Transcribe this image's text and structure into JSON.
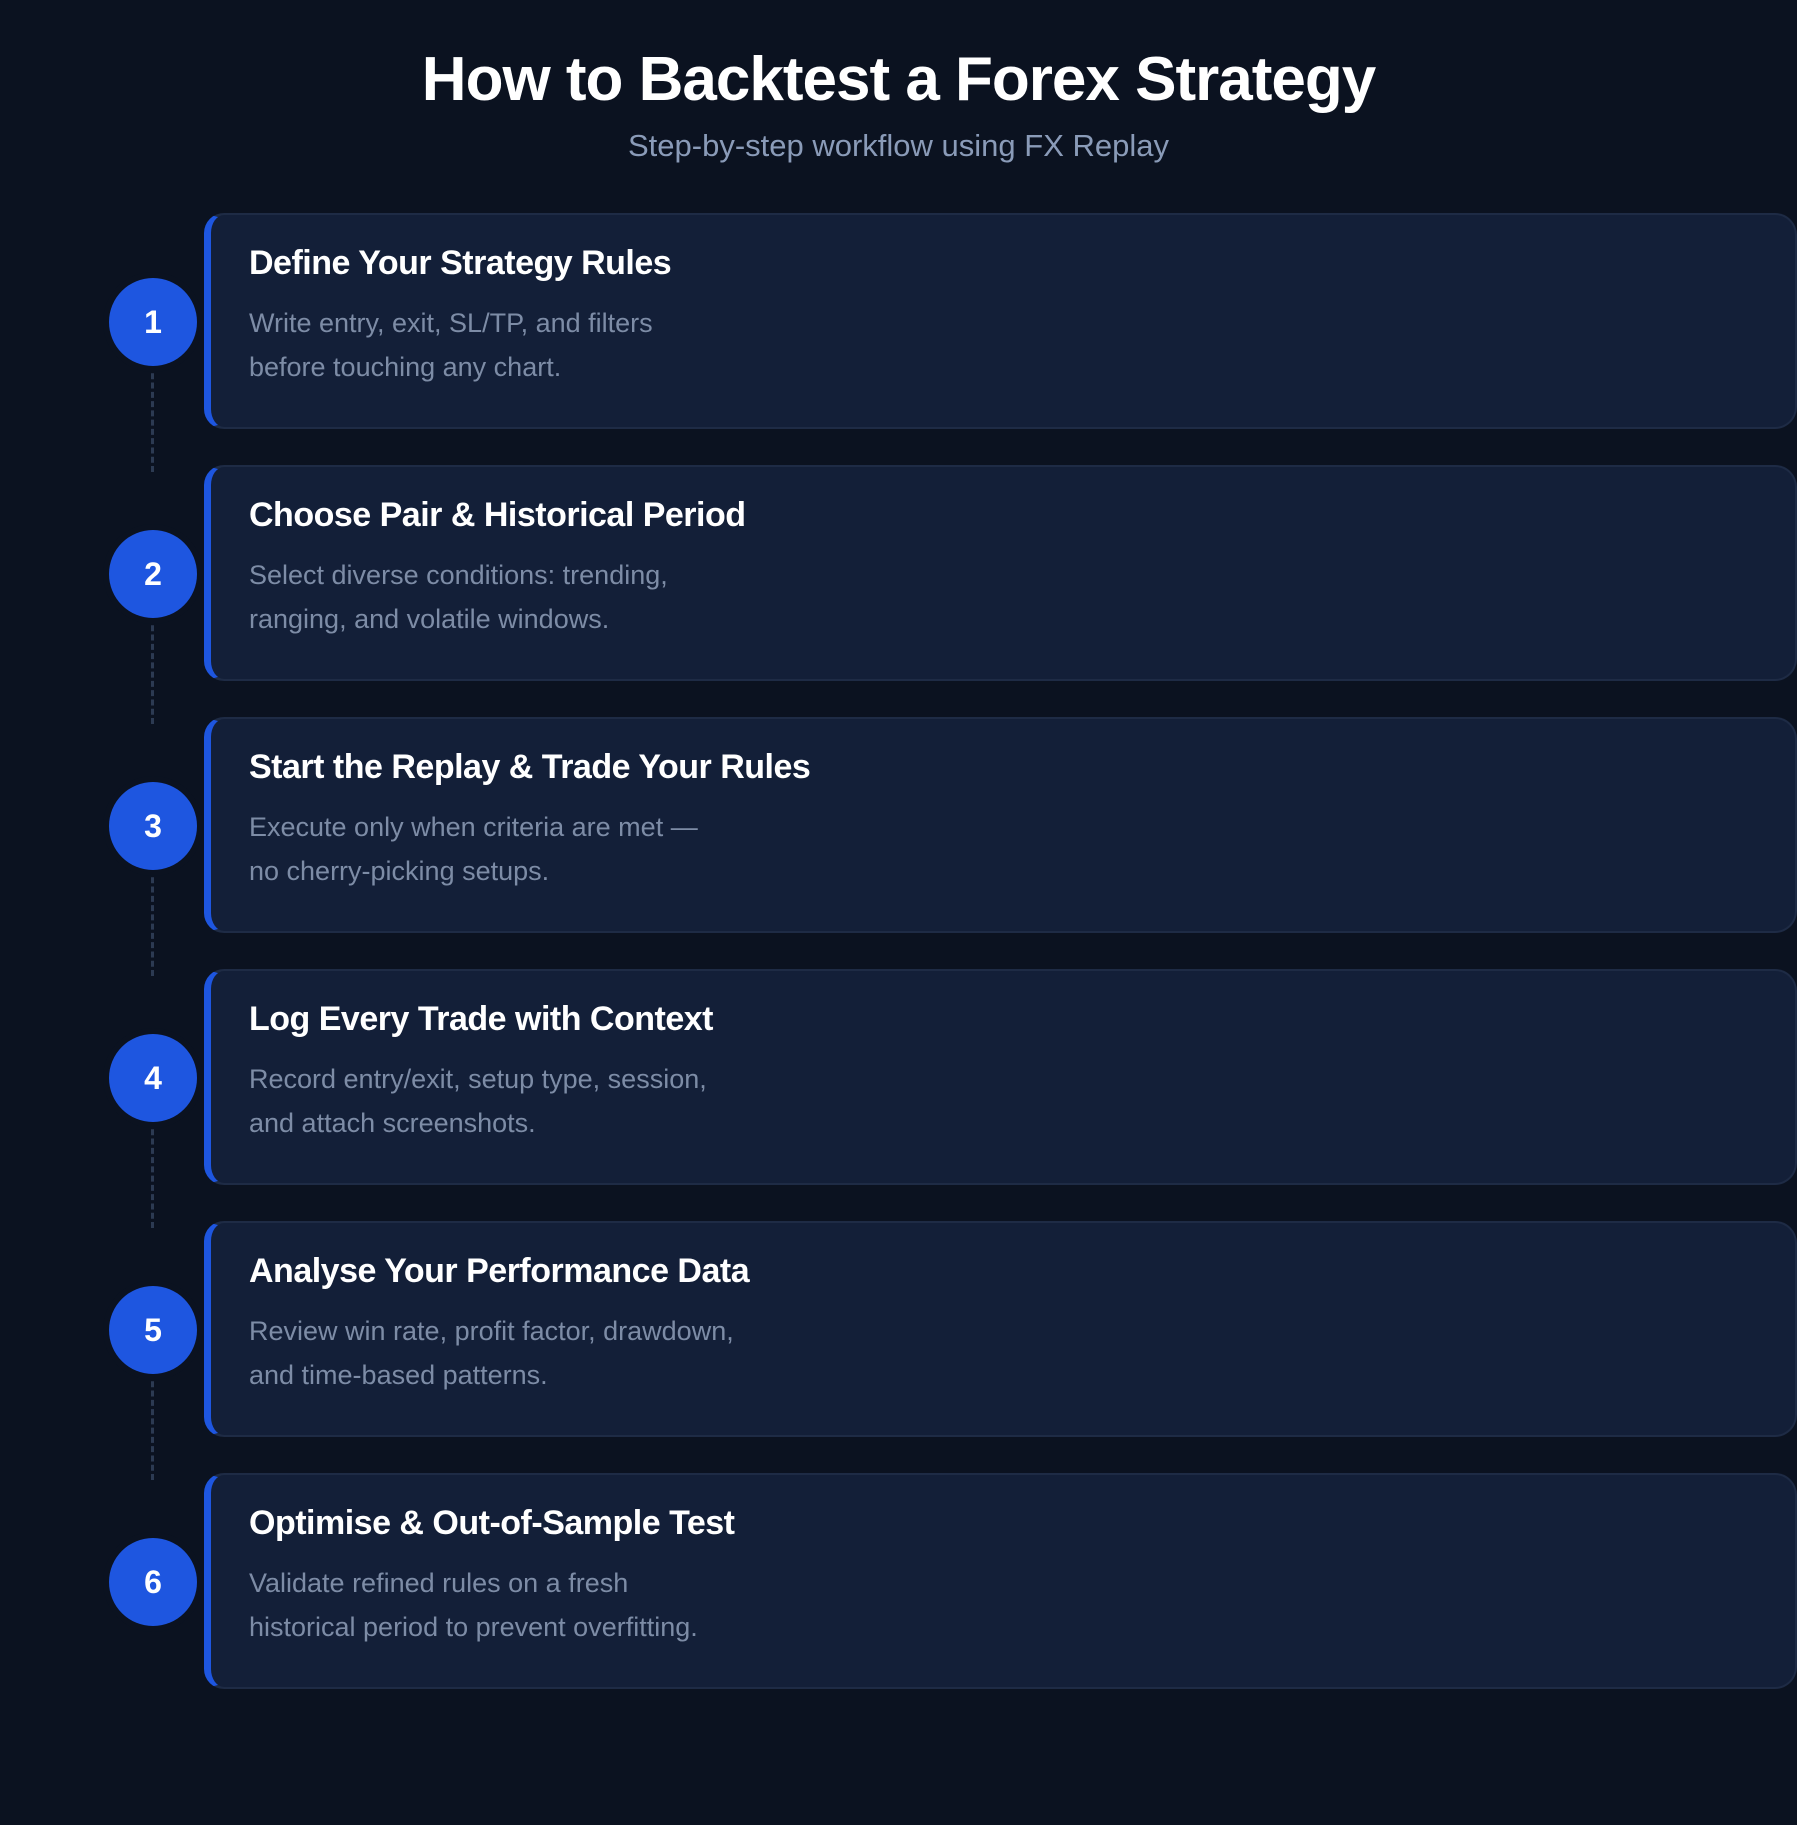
{
  "header": {
    "title": "How to Backtest a Forex Strategy",
    "subtitle": "Step-by-step workflow using FX Replay"
  },
  "colors": {
    "background": "#0b1220",
    "card": "#131f38",
    "accent": "#1e56e0",
    "title_text": "#ffffff",
    "muted_text": "#7d8ca6"
  },
  "steps": [
    {
      "number": "1",
      "title": "Define Your Strategy Rules",
      "description": "Write entry, exit, SL/TP, and filters\nbefore touching any chart."
    },
    {
      "number": "2",
      "title": "Choose Pair & Historical Period",
      "description": "Select diverse conditions: trending,\nranging, and volatile windows."
    },
    {
      "number": "3",
      "title": "Start the Replay & Trade Your Rules",
      "description": "Execute only when criteria are met —\nno cherry-picking setups."
    },
    {
      "number": "4",
      "title": "Log Every Trade with Context",
      "description": "Record entry/exit, setup type, session,\nand attach screenshots."
    },
    {
      "number": "5",
      "title": "Analyse Your Performance Data",
      "description": "Review win rate, profit factor, drawdown,\nand time-based patterns."
    },
    {
      "number": "6",
      "title": "Optimise & Out-of-Sample Test",
      "description": "Validate refined rules on a fresh\nhistorical period to prevent overfitting."
    }
  ]
}
